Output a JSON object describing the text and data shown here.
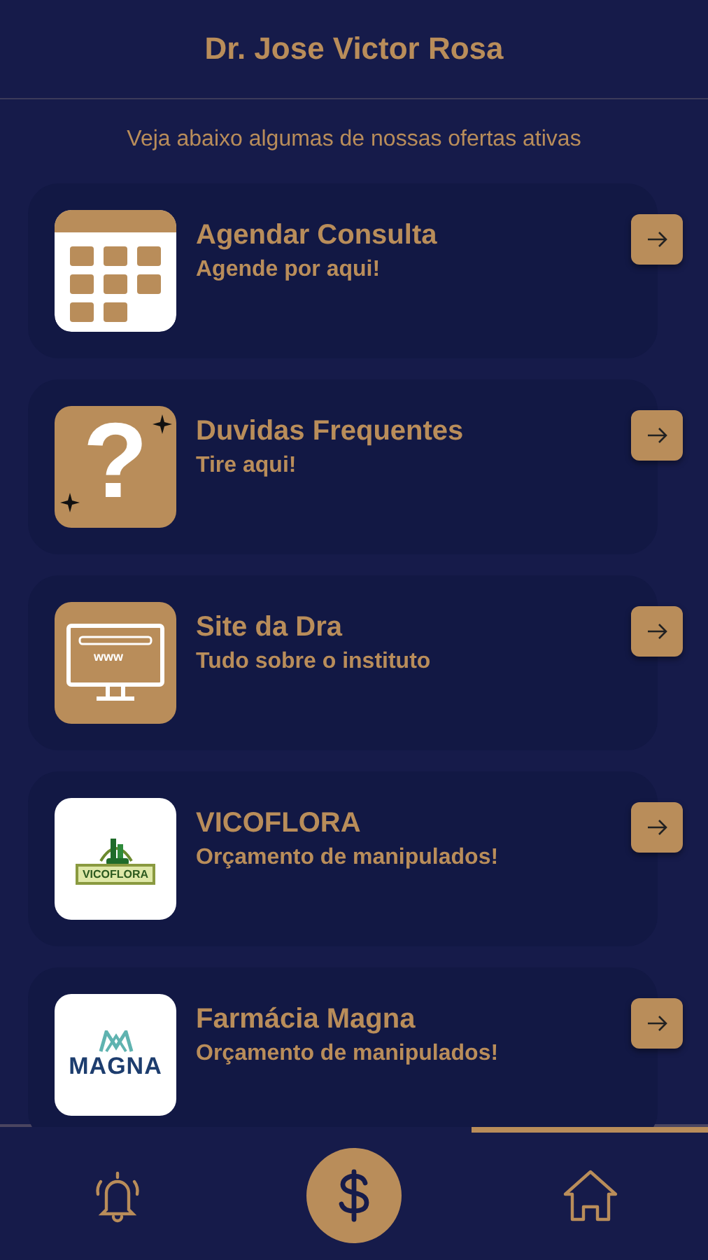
{
  "header": {
    "title": "Dr. Jose Victor Rosa"
  },
  "intro": "Veja abaixo algumas de nossas ofertas ativas",
  "offers": [
    {
      "kind": "calendar",
      "title": "Agendar Consulta",
      "subtitle": "Agende por aqui!"
    },
    {
      "kind": "question",
      "glyph": "?",
      "title": "Duvidas Frequentes",
      "subtitle": "Tire aqui!"
    },
    {
      "kind": "website",
      "screen_text": "www",
      "title": "Site da Dra",
      "subtitle": "Tudo sobre o instituto"
    },
    {
      "kind": "vicoflora",
      "logo_text": "VICOFLORA",
      "title": "VICOFLORA",
      "subtitle": "Orçamento de manipulados!"
    },
    {
      "kind": "magna",
      "logo_text": "MAGNA",
      "title": "Farmácia Magna",
      "subtitle": "Orçamento de manipulados!"
    }
  ],
  "nav": [
    {
      "kind": "bell",
      "selected": false
    },
    {
      "kind": "dollar",
      "selected": false
    },
    {
      "kind": "home",
      "selected": true
    }
  ]
}
